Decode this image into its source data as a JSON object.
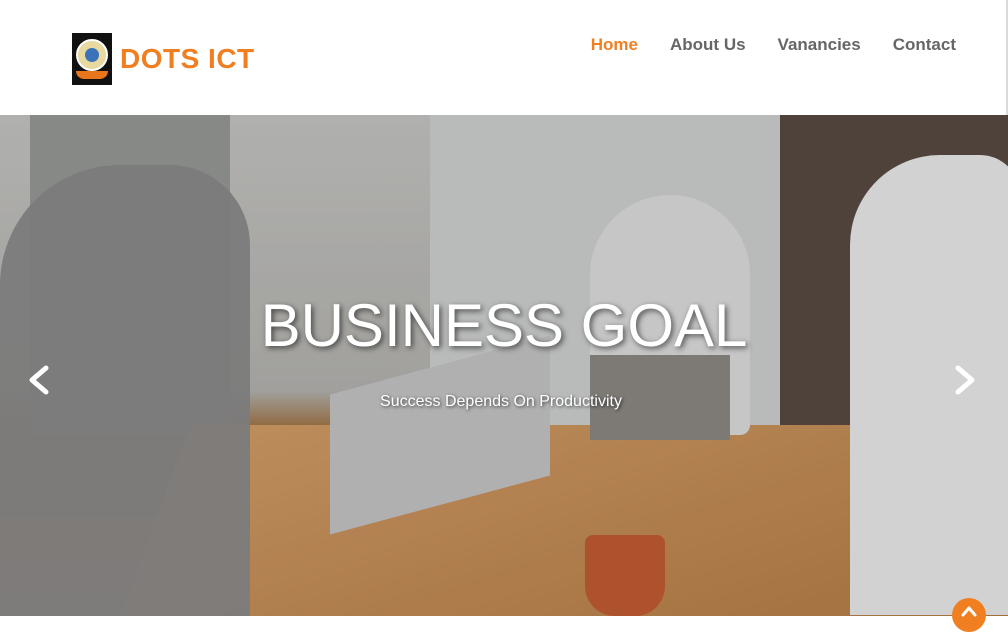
{
  "brand": {
    "name": "DOTS ICT"
  },
  "nav": {
    "items": [
      {
        "label": "Home",
        "active": true
      },
      {
        "label": "About Us",
        "active": false
      },
      {
        "label": "Vanancies",
        "active": false
      },
      {
        "label": "Contact",
        "active": false
      }
    ]
  },
  "hero": {
    "title": "BUSINESS GOAL",
    "subtitle": "Success Depends On Productivity"
  },
  "icons": {
    "prev": "chevron-left-icon",
    "next": "chevron-right-icon",
    "scroll_top": "chevron-up-icon"
  },
  "colors": {
    "accent": "#f07f22",
    "nav_text": "#666666"
  }
}
